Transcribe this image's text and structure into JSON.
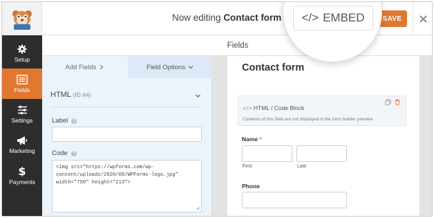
{
  "header": {
    "editing_prefix": "Now editing",
    "form_name": "Contact form",
    "save_label": "SAVE",
    "embed_label": "EMBED"
  },
  "sidebar": {
    "items": [
      {
        "label": "Setup",
        "icon": "gear-icon"
      },
      {
        "label": "Fields",
        "icon": "list-icon",
        "active": true
      },
      {
        "label": "Settings",
        "icon": "sliders-icon"
      },
      {
        "label": "Marketing",
        "icon": "megaphone-icon"
      },
      {
        "label": "Payments",
        "icon": "dollar-icon"
      }
    ]
  },
  "fields_header": "Fields",
  "panel": {
    "tabs": [
      {
        "label": "Add Fields",
        "icon": "chevron-right-icon"
      },
      {
        "label": "Field Options",
        "icon": "chevron-down-icon"
      }
    ],
    "field_name": "HTML",
    "field_id": "(ID #4)",
    "label_label": "Label",
    "label_value": "",
    "code_label": "Code",
    "code_value": "<img src=\"https://wpforms.com/wp-\ncontent/uploads/2020/09/WPForms-logo.jpg\"\nwidth=\"750\" height=\"213\">"
  },
  "preview": {
    "form_title": "Contact form",
    "html_block_title": "HTML / Code Block",
    "html_block_desc": "Contents of this field are not displayed in the form builder preview.",
    "name_label": "Name",
    "required_mark": "*",
    "first_label": "First",
    "last_label": "Last",
    "phone_label": "Phone"
  },
  "colors": {
    "accent": "#e27730",
    "sidebar_bg": "#2d2d2d",
    "panel_bg": "#ebf3fb"
  }
}
